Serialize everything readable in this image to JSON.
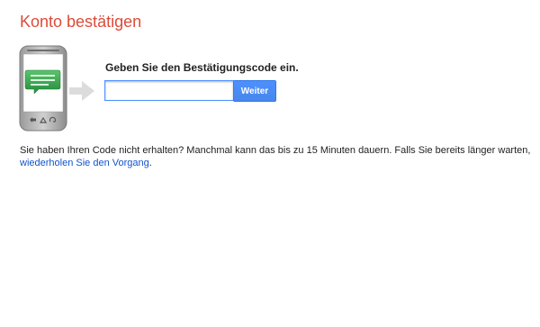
{
  "page": {
    "title": "Konto bestätigen"
  },
  "verification": {
    "instruction": "Geben Sie den Bestätigungscode ein.",
    "code_value": "",
    "submit_label": "Weiter"
  },
  "help": {
    "text": "Sie haben Ihren Code nicht erhalten? Manchmal kann das bis zu 15 Minuten dauern. Falls Sie bereits länger warten, ",
    "link_text": "wiederholen Sie den Vorgang",
    "suffix": "."
  },
  "icons": {
    "phone": "phone-message-icon",
    "arrow": "arrow-right-icon"
  },
  "colors": {
    "title": "#dd4b39",
    "button": "#4d90fe",
    "link": "#1155cc",
    "message_bubble": "#2e9e49"
  }
}
